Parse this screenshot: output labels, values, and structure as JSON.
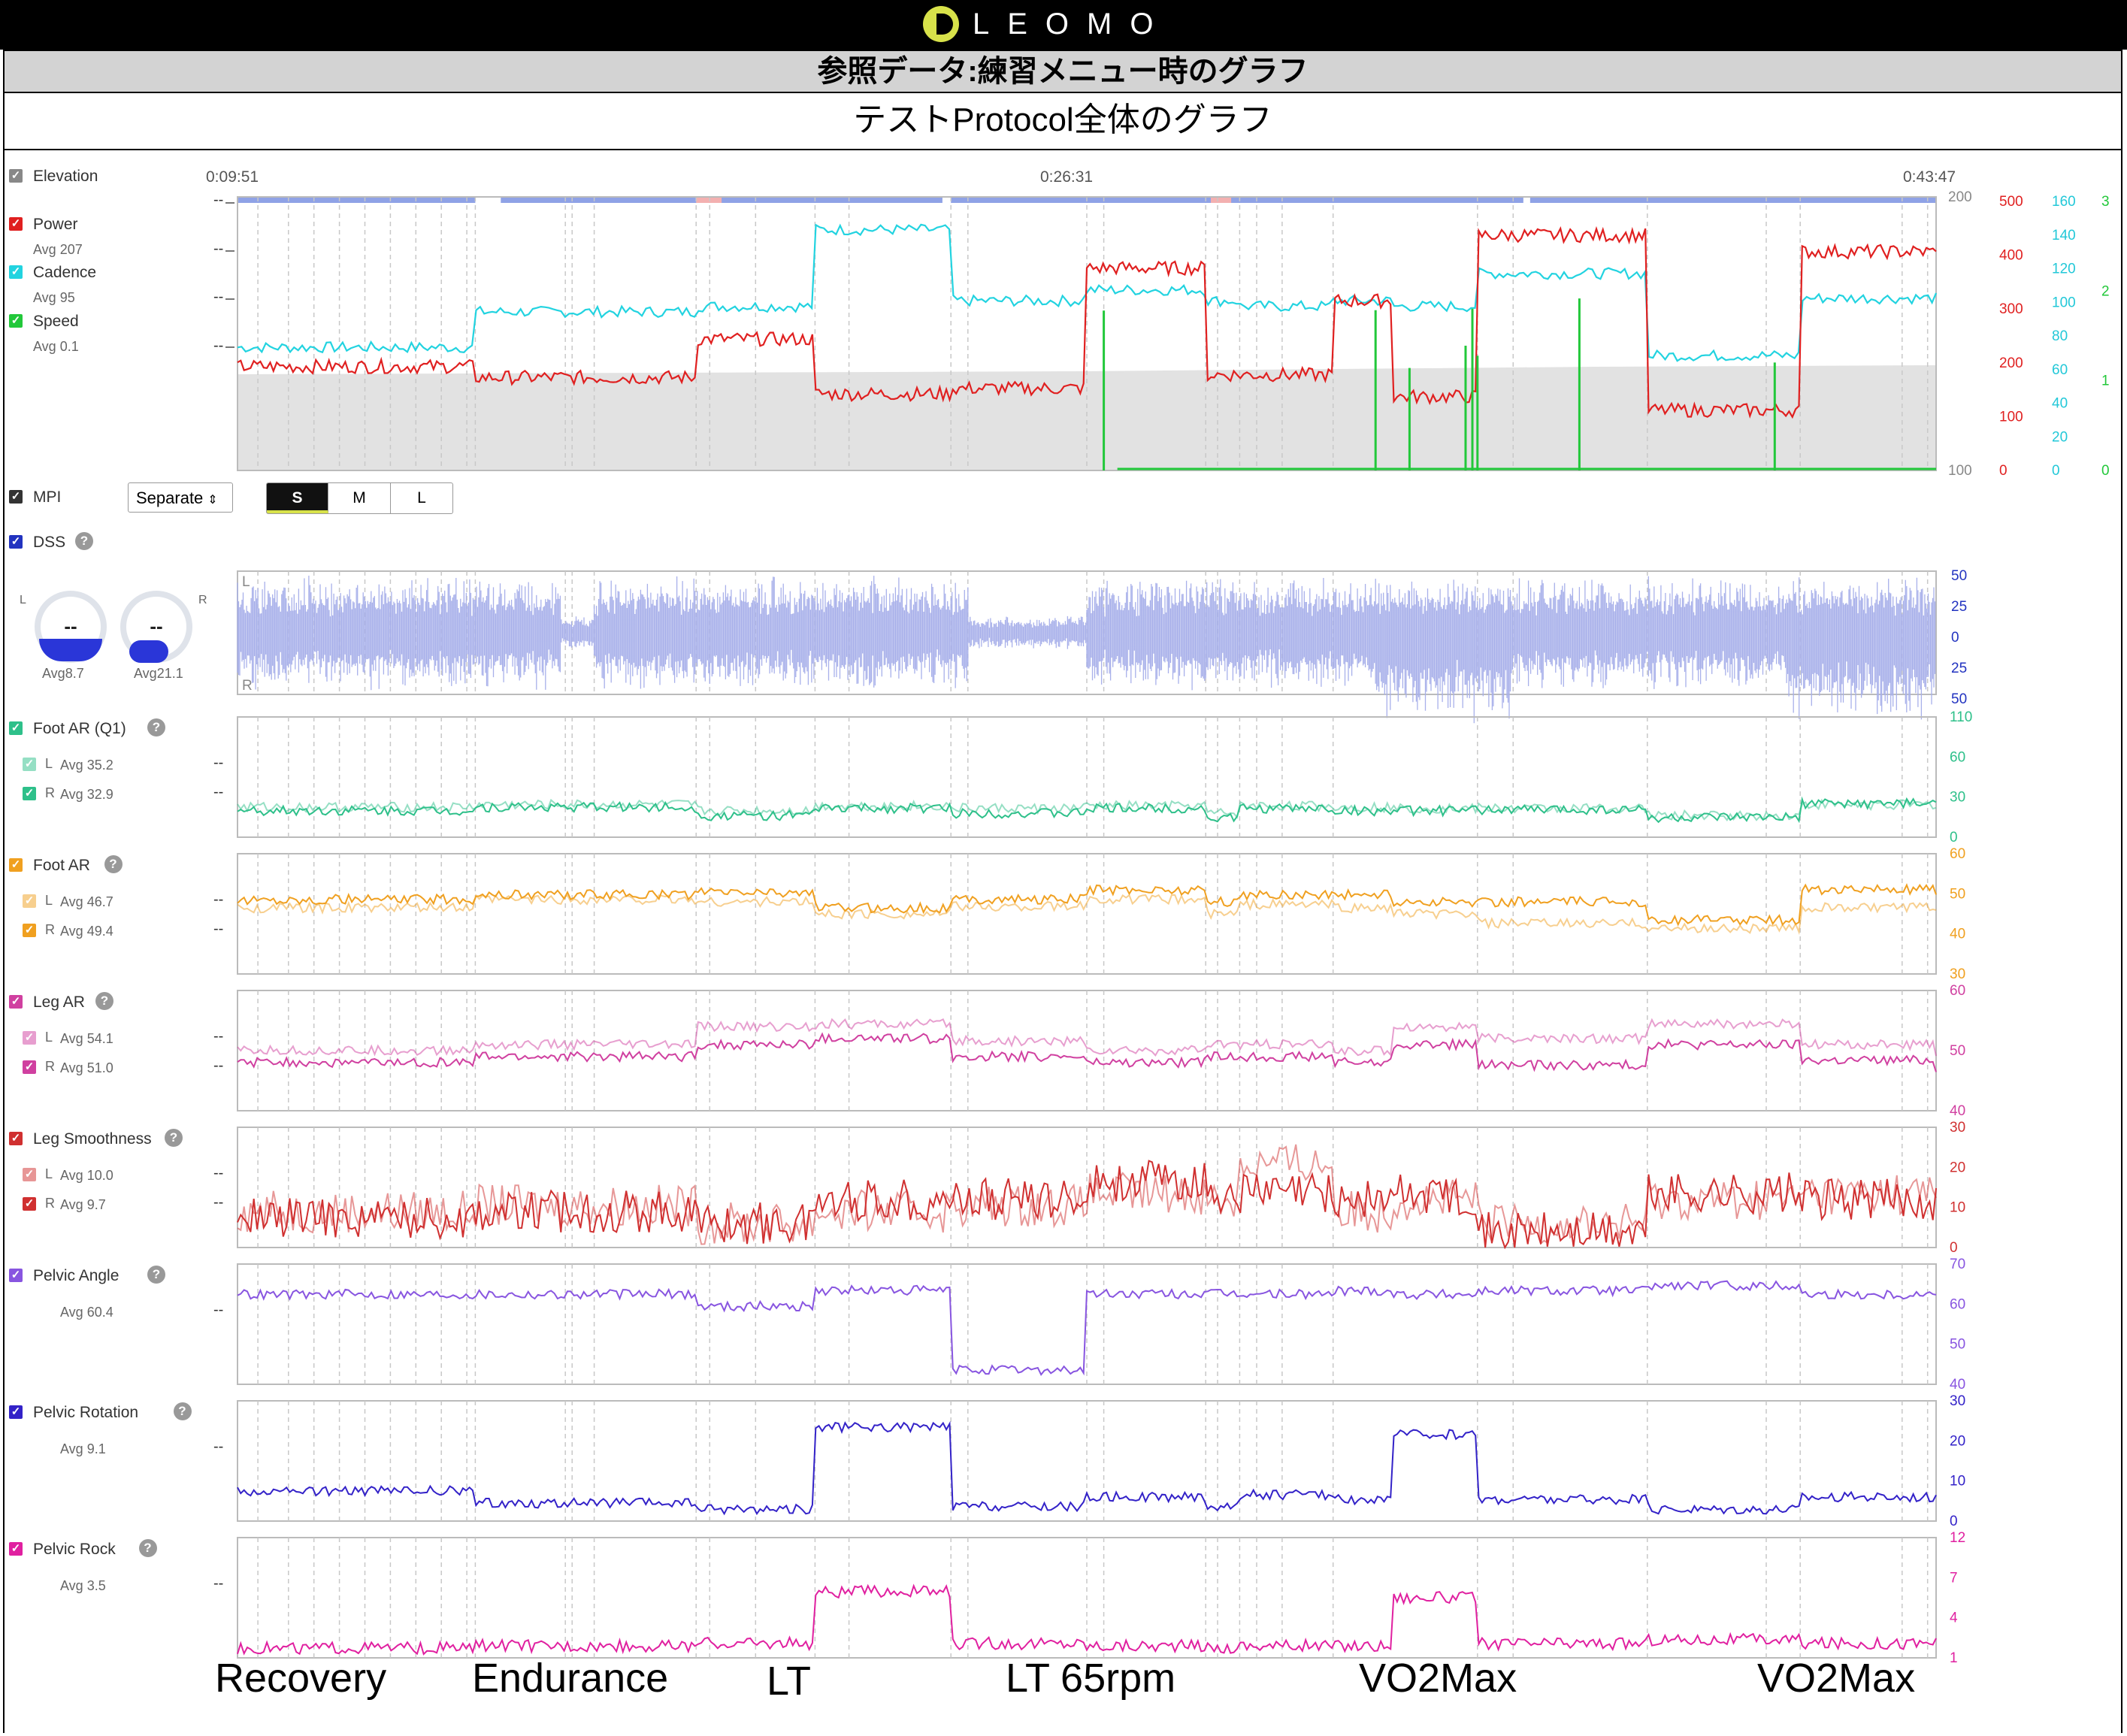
{
  "header": {
    "logo_text": "LEOMO",
    "title": "参照データ:練習メニュー時のグラフ",
    "subtitle": "テストProtocol全体のグラフ"
  },
  "timeline": {
    "start": "0:09:51",
    "mid": "0:26:31",
    "end": "0:43:47"
  },
  "main_chart": {
    "elevation": {
      "label": "Elevation"
    },
    "power": {
      "label": "Power",
      "avg": "Avg 207",
      "color": "#e02020"
    },
    "cadence": {
      "label": "Cadence",
      "avg": "Avg 95",
      "color": "#22d3e0"
    },
    "speed": {
      "label": "Speed",
      "avg": "Avg 0.1",
      "color": "#22c83a"
    },
    "ticks_elevation": [
      "200",
      "100"
    ],
    "ticks_power": [
      "500",
      "400",
      "300",
      "200",
      "100",
      "0"
    ],
    "ticks_cadence": [
      "160",
      "140",
      "120",
      "100",
      "80",
      "60",
      "40",
      "20",
      "0"
    ],
    "ticks_speed": [
      "3",
      "2",
      "1",
      "0"
    ]
  },
  "mpi": {
    "label": "MPI",
    "mode": "Separate",
    "sizes": [
      "S",
      "M",
      "L"
    ]
  },
  "dss": {
    "label": "DSS",
    "left_label": "L",
    "right_label": "R",
    "gauge_value": "--",
    "left_avg": "Avg8.7",
    "right_avg": "Avg21.1",
    "ticks": [
      "50",
      "25",
      "0",
      "25",
      "50"
    ],
    "axis_l": "L",
    "axis_r": "R",
    "color": "#2233c0"
  },
  "panels": [
    {
      "label": "Foot AR (Q1)",
      "color": "#2ec08a",
      "l_avg": "Avg 35.2",
      "r_avg": "Avg 32.9",
      "ticks": [
        "110",
        "60",
        "30",
        "0"
      ]
    },
    {
      "label": "Foot AR",
      "color": "#f0a020",
      "l_avg": "Avg 46.7",
      "r_avg": "Avg 49.4",
      "ticks": [
        "60",
        "50",
        "40",
        "30"
      ]
    },
    {
      "label": "Leg AR",
      "color": "#d040a0",
      "l_avg": "Avg 54.1",
      "r_avg": "Avg 51.0",
      "ticks": [
        "60",
        "50",
        "40"
      ]
    },
    {
      "label": "Leg Smoothness",
      "color": "#d03030",
      "l_avg": "Avg 10.0",
      "r_avg": "Avg 9.7",
      "ticks": [
        "30",
        "20",
        "10",
        "0"
      ]
    },
    {
      "label": "Pelvic Angle",
      "color": "#8855e0",
      "avg": "Avg 60.4",
      "ticks": [
        "70",
        "60",
        "50",
        "40"
      ]
    },
    {
      "label": "Pelvic Rotation",
      "color": "#3322c8",
      "avg": "Avg 9.1",
      "ticks": [
        "30",
        "20",
        "10",
        "0"
      ]
    },
    {
      "label": "Pelvic Rock",
      "color": "#e020a0",
      "avg": "Avg 3.5",
      "ticks": [
        "12",
        "7",
        "4",
        "1"
      ]
    }
  ],
  "zones": [
    "Recovery",
    "Endurance",
    "LT",
    "LT 65rpm",
    "VO2Max",
    "VO2Max"
  ],
  "series_flag": {
    "L": "L",
    "R": "R"
  },
  "empty": "--",
  "help": "?"
}
